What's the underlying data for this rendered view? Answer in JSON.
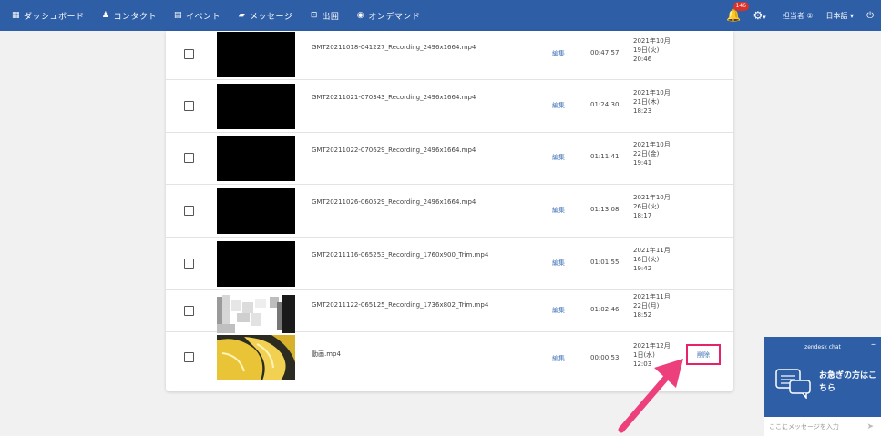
{
  "nav": {
    "items": [
      {
        "icon": "▦",
        "label": "ダッシュボード"
      },
      {
        "icon": "♟",
        "label": "コンタクト"
      },
      {
        "icon": "▤",
        "label": "イベント"
      },
      {
        "icon": "▰",
        "label": "メッセージ"
      },
      {
        "icon": "⊡",
        "label": "出囲"
      },
      {
        "icon": "◉",
        "label": "オンデマンド"
      }
    ],
    "badge_count": "146",
    "user": "担当者 ②",
    "language": "日本語 ▾"
  },
  "recordings": [
    {
      "name": "GMT20211018-041227_Recording_2496x1664.mp4",
      "edit": "編集",
      "duration": "00:47:57",
      "date_line1": "2021年10月",
      "date_line2": "19日(火)",
      "date_line3": "20:46"
    },
    {
      "name": "GMT20211021-070343_Recording_2496x1664.mp4",
      "edit": "編集",
      "duration": "01:24:30",
      "date_line1": "2021年10月",
      "date_line2": "21日(木)",
      "date_line3": "18:23"
    },
    {
      "name": "GMT20211022-070629_Recording_2496x1664.mp4",
      "edit": "編集",
      "duration": "01:11:41",
      "date_line1": "2021年10月",
      "date_line2": "22日(金)",
      "date_line3": "19:41"
    },
    {
      "name": "GMT20211026-060529_Recording_2496x1664.mp4",
      "edit": "編集",
      "duration": "01:13:08",
      "date_line1": "2021年10月",
      "date_line2": "26日(火)",
      "date_line3": "18:17"
    },
    {
      "name": "GMT20211116-065253_Recording_1760x900_Trim.mp4",
      "edit": "編集",
      "duration": "01:01:55",
      "date_line1": "2021年11月",
      "date_line2": "16日(火)",
      "date_line3": "19:42"
    },
    {
      "name": "GMT20211122-065125_Recording_1736x802_Trim.mp4",
      "edit": "編集",
      "duration": "01:02:46",
      "date_line1": "2021年11月",
      "date_line2": "22日(月)",
      "date_line3": "18:52"
    },
    {
      "name": "動画.mp4",
      "edit": "編集",
      "duration": "00:00:53",
      "date_line1": "2021年12月",
      "date_line2": "1日(水)",
      "date_line3": "12:03",
      "delete": "削除"
    }
  ],
  "chat": {
    "title": "zendesk chat",
    "minimize": "–",
    "message": "お急ぎの方はこちら",
    "placeholder": "ここにメッセージを入力",
    "send": "➤"
  },
  "colors": {
    "header": "#2e5ea6",
    "highlight": "#e6226a",
    "link": "#3d6fb8"
  }
}
